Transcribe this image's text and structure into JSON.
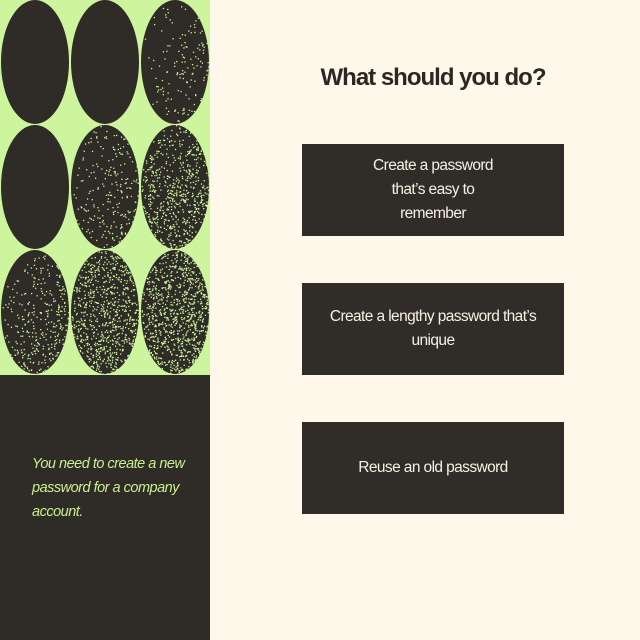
{
  "question": "What should you do?",
  "scenario": "You need to create a new password for a company account.",
  "answers": [
    {
      "label": "Create a password that’s easy to remember"
    },
    {
      "label": "Create a lengthy password that’s unique"
    },
    {
      "label": "Reuse an old password"
    }
  ],
  "colors": {
    "accent_green": "#ccf59e",
    "dark": "#2f2b26",
    "cream": "#fdf8ea"
  }
}
